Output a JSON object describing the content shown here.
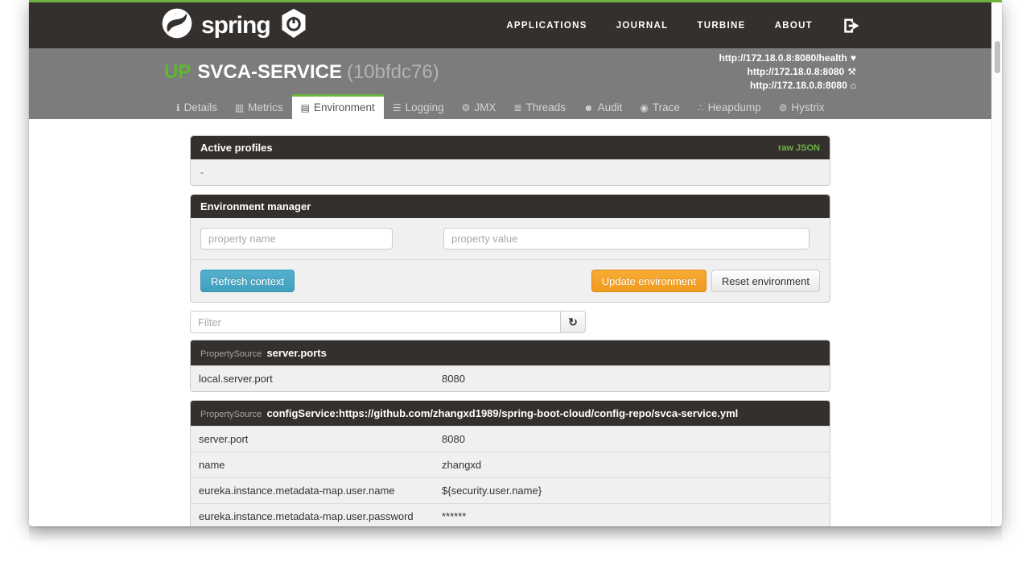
{
  "navbar": {
    "brand": "spring",
    "items": [
      "APPLICATIONS",
      "JOURNAL",
      "TURBINE",
      "ABOUT"
    ]
  },
  "header": {
    "status": "UP",
    "service_name": "SVCA-SERVICE",
    "instance_id": "(10bfdc76)",
    "links": [
      {
        "url": "http://172.18.0.8:8080/health",
        "icon_name": "heartbeat-icon"
      },
      {
        "url": "http://172.18.0.8:8080",
        "icon_name": "wrench-icon"
      },
      {
        "url": "http://172.18.0.8:8080",
        "icon_name": "home-icon"
      }
    ]
  },
  "icons": {
    "details": "ℹ",
    "metrics": "▥",
    "environment": "▤",
    "logging": "☰",
    "jmx": "⚙",
    "threads": "≣",
    "audit": "☻",
    "trace": "◉",
    "heapdump": "∴",
    "hystrix": "⚙",
    "heartbeat": "♥",
    "wrench": "⚒",
    "home": "⌂",
    "refresh": "↻"
  },
  "tabs": [
    {
      "label": "Details"
    },
    {
      "label": "Metrics"
    },
    {
      "label": "Environment",
      "active": true
    },
    {
      "label": "Logging"
    },
    {
      "label": "JMX"
    },
    {
      "label": "Threads"
    },
    {
      "label": "Audit"
    },
    {
      "label": "Trace"
    },
    {
      "label": "Heapdump"
    },
    {
      "label": "Hystrix"
    }
  ],
  "active_profiles": {
    "title": "Active profiles",
    "action": "raw JSON",
    "content": "-"
  },
  "environment_manager": {
    "title": "Environment manager",
    "property_name_placeholder": "property name",
    "property_value_placeholder": "property value",
    "refresh_label": "Refresh context",
    "update_label": "Update environment",
    "reset_label": "Reset environment"
  },
  "filter": {
    "placeholder": "Filter"
  },
  "tables": [
    {
      "source_label": "PropertySource",
      "source_name": "server.ports",
      "rows": [
        [
          "local.server.port",
          "8080"
        ]
      ]
    },
    {
      "source_label": "PropertySource",
      "source_name": "configService:https://github.com/zhangxd1989/spring-boot-cloud/config-repo/svca-service.yml",
      "rows": [
        [
          "server.port",
          "8080"
        ],
        [
          "name",
          "zhangxd"
        ],
        [
          "eureka.instance.metadata-map.user.name",
          "${security.user.name}"
        ],
        [
          "eureka.instance.metadata-map.user.password",
          "******"
        ],
        [
          "",
          ""
        ]
      ]
    }
  ],
  "colors": {
    "spring_green": "#6db33f",
    "status_up_green": "#5fb832",
    "navbar_dark": "#34302d",
    "header_gray": "#7c7c7c",
    "panel_body": "#f0f0f0",
    "info_button_blue": "#41a0bd",
    "warning_button_orange": "#f0a02a"
  }
}
